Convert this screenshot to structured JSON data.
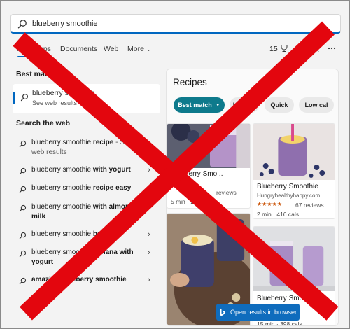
{
  "search": {
    "query": "blueberry smoothie"
  },
  "tabs": {
    "all": "All",
    "apps": "Apps",
    "documents": "Documents",
    "web": "Web",
    "more": "More"
  },
  "header": {
    "points": "15"
  },
  "left": {
    "best_match_heading": "Best match",
    "best_match": {
      "title": "blueberry smoothie",
      "subtitle": "See web results"
    },
    "search_web_heading": "Search the web",
    "results": [
      {
        "prefix": "blueberry smoothie ",
        "bold": "recipe",
        "suffix": " - See web results"
      },
      {
        "prefix": "blueberry smoothie ",
        "bold": "with yogurt",
        "suffix": ""
      },
      {
        "prefix": "blueberry smoothie ",
        "bold": "recipe easy",
        "suffix": ""
      },
      {
        "prefix": "blueberry smoothie ",
        "bold": "with almond milk",
        "suffix": ""
      },
      {
        "prefix": "blueberry smoothie ",
        "bold": "bowl",
        "suffix": ""
      },
      {
        "prefix": "blueberry smoothie ",
        "bold": "banana with yogurt",
        "suffix": ""
      },
      {
        "prefix": "",
        "bold": "amazing blueberry smoothie",
        "suffix": ""
      }
    ]
  },
  "recipes": {
    "title": "Recipes",
    "chips": [
      "Best match",
      "Healthy",
      "Quick",
      "Low cal"
    ],
    "cards": [
      {
        "name": "Blueberry Smo...",
        "source": "",
        "reviews": "reviews",
        "meta": "5 min  ·  211 cals"
      },
      {
        "name": "Blueberry Smoothie",
        "source": "Hungryhealthyhappy.com",
        "reviews": "67 reviews",
        "meta": "2 min  ·  416 cals"
      },
      {
        "name": "",
        "source": "",
        "reviews": "",
        "meta": ""
      },
      {
        "name": "Blueberry Smo...",
        "source": "",
        "reviews": "",
        "meta": "15 min  ·  398 cals"
      }
    ],
    "open_button": "Open results in browser"
  },
  "colors": {
    "accent": "#0067c0",
    "chip_active": "#0e7a8c",
    "open_button": "#0f6cbd",
    "cross": "#e3060e"
  }
}
